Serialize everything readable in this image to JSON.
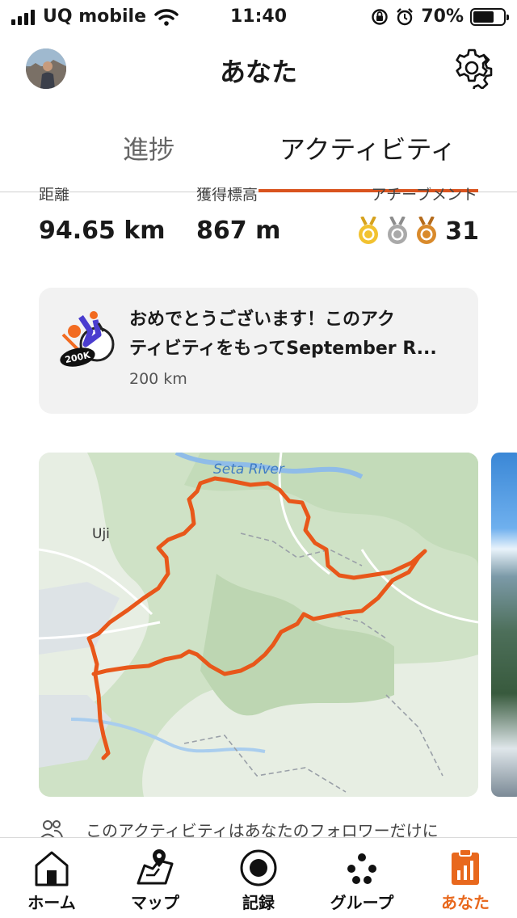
{
  "status_bar": {
    "carrier": "UQ mobile",
    "time": "11:40",
    "battery": "70%",
    "battery_level": 0.7
  },
  "header": {
    "title": "あなた",
    "avatar_icon": "profile-avatar",
    "settings_icon": "gear-icon"
  },
  "tabs": [
    {
      "label": "進捗",
      "active": false
    },
    {
      "label": "アクティビティ",
      "active": true
    }
  ],
  "stats": {
    "distance": {
      "label": "距離",
      "value": "94.65 km"
    },
    "elevation": {
      "label": "獲得標高",
      "value": "867 m"
    },
    "achievements": {
      "label": "アチーブメント",
      "count": "31",
      "medals": [
        "gold",
        "silver",
        "bronze"
      ]
    }
  },
  "banner": {
    "line1": "おめでとうございます！このアク",
    "line2": "ティビティをもってSeptember R...",
    "sub": "200 km",
    "badge_text": "200K"
  },
  "map": {
    "labels": [
      "Seta River",
      "Uji"
    ],
    "route_color": "#e8571a"
  },
  "notice": {
    "text": "このアクティビティはあなたのフォロワーだけに"
  },
  "bottom_nav": [
    {
      "label": "ホーム",
      "icon": "home-icon",
      "active": false
    },
    {
      "label": "マップ",
      "icon": "map-icon",
      "active": false
    },
    {
      "label": "記録",
      "icon": "record-icon",
      "active": false
    },
    {
      "label": "グループ",
      "icon": "groups-icon",
      "active": false
    },
    {
      "label": "あなた",
      "icon": "you-icon",
      "active": true
    }
  ],
  "colors": {
    "accent": "#e8681d",
    "tab_underline": "#d9531e",
    "gold": "#f2c230",
    "silver": "#a9a9a9",
    "bronze": "#d98a2b"
  }
}
